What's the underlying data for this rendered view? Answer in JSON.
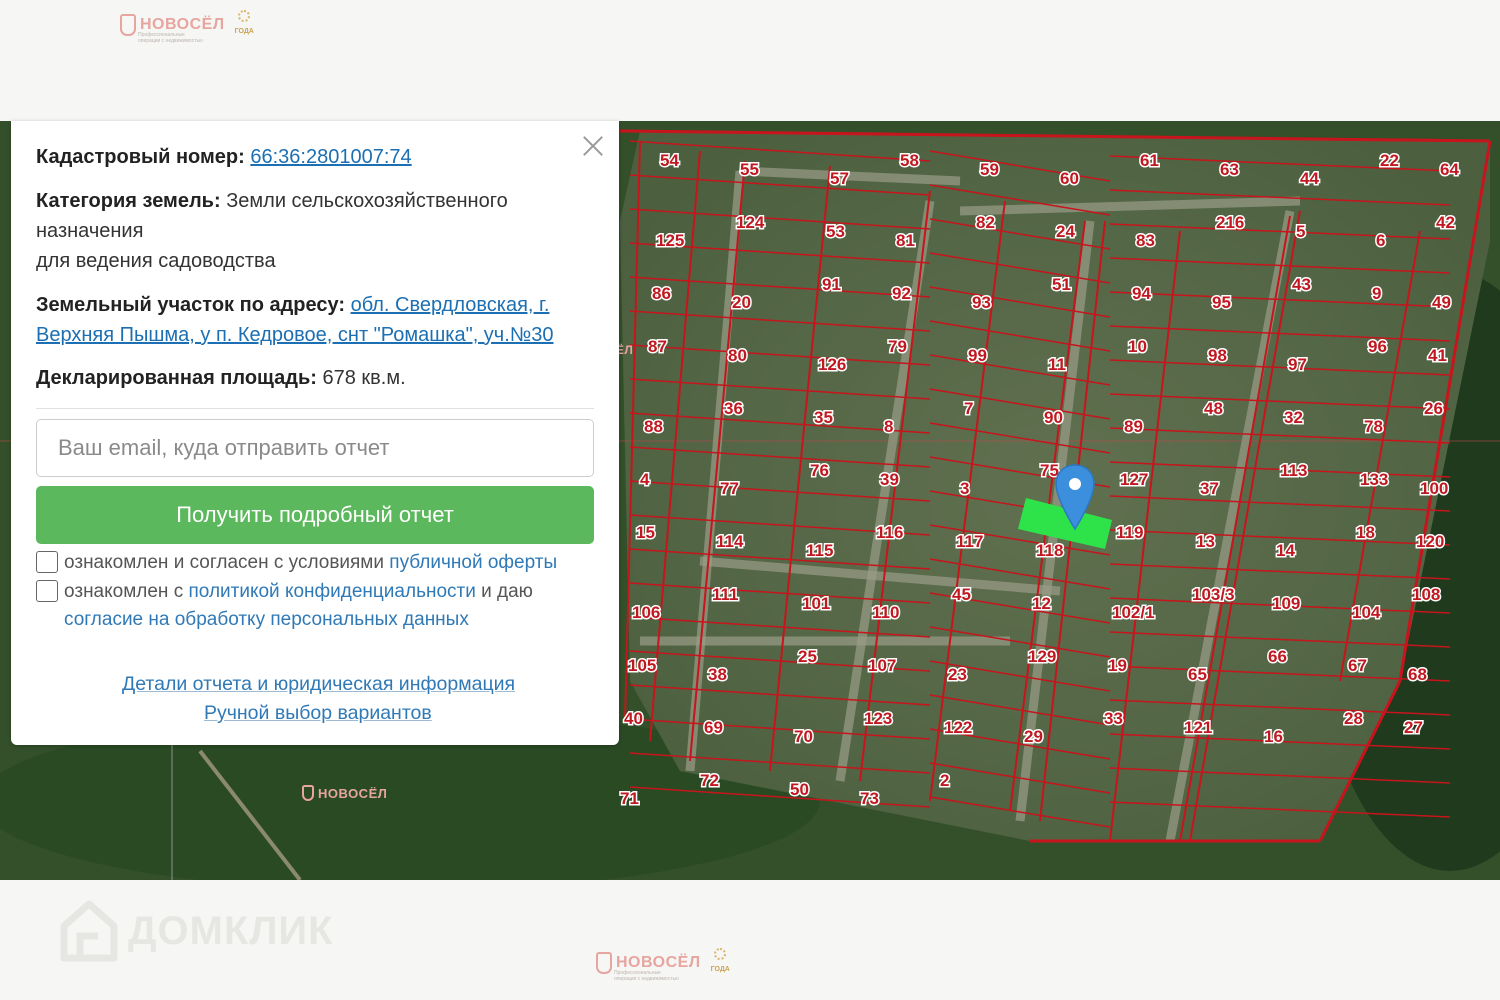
{
  "header_logo": {
    "brand": "НОВОСЁЛ",
    "tagline": "Профессиональные операции с недвижимостью",
    "award_year": "ГОДА"
  },
  "map": {
    "watermark_brand": "НОВОСЁЛ",
    "selected_plot_color": "#2ee34a",
    "plot_border_color": "#c8141c",
    "plot_numbers": [
      "54",
      "55",
      "57",
      "58",
      "59",
      "60",
      "61",
      "63",
      "44",
      "22",
      "64",
      "125",
      "124",
      "53",
      "81",
      "82",
      "24",
      "83",
      "216",
      "5",
      "6",
      "42",
      "86",
      "20",
      "91",
      "92",
      "93",
      "51",
      "94",
      "95",
      "43",
      "9",
      "49",
      "87",
      "80",
      "126",
      "79",
      "99",
      "11",
      "10",
      "98",
      "97",
      "96",
      "41",
      "88",
      "36",
      "35",
      "8",
      "7",
      "90",
      "89",
      "48",
      "32",
      "78",
      "26",
      "4",
      "77",
      "76",
      "39",
      "3",
      "75",
      "127",
      "37",
      "113",
      "133",
      "100",
      "15",
      "114",
      "115",
      "116",
      "117",
      "118",
      "119",
      "13",
      "14",
      "18",
      "120",
      "106",
      "111",
      "101",
      "110",
      "45",
      "12",
      "102/1",
      "103/3",
      "109",
      "104",
      "108",
      "105",
      "38",
      "25",
      "107",
      "23",
      "129",
      "19",
      "65",
      "66",
      "67",
      "68",
      "40",
      "69",
      "70",
      "123",
      "122",
      "29",
      "33",
      "121",
      "16",
      "28",
      "27",
      "71",
      "72",
      "50",
      "73",
      "2"
    ]
  },
  "panel": {
    "cadastral_label": "Кадастровый номер:",
    "cadastral_value": "66:36:2801007:74",
    "category_label": "Категория земель:",
    "category_value_line1": "Земли сельскохозяйственного",
    "category_value_line2": "назначения",
    "category_value_line3": "для ведения садоводства",
    "address_label": "Земельный участок по адресу:",
    "address_value_part1": "обл. Свердловская, г.",
    "address_value_part2": "Верхняя Пышма, у п. Кедровое, снт \"Ромашка\", уч.№30",
    "area_label": "Декларированная площадь:",
    "area_value": "678 кв.м.",
    "email_placeholder": "Ваш email, куда отправить отчет",
    "email_value": "",
    "submit_label": "Получить подробный отчет",
    "agree1_text": "ознакомлен и согласен с условиями",
    "agree1_link": "публичной оферты",
    "agree2_text": "ознакомлен с",
    "agree2_link1": "политикой конфиденциальности",
    "agree2_text2": "и даю",
    "agree2_link2": "согласие на обработку персональных данных",
    "details_link": "Детали отчета и юридическая информация",
    "manual_link": "Ручной выбор вариантов"
  },
  "footer": {
    "domclick_label": "ДОМКЛИК",
    "logo_brand": "НОВОСЁЛ",
    "logo_tagline": "Профессиональные операции с недвижимостью",
    "award_year": "ГОДА"
  }
}
